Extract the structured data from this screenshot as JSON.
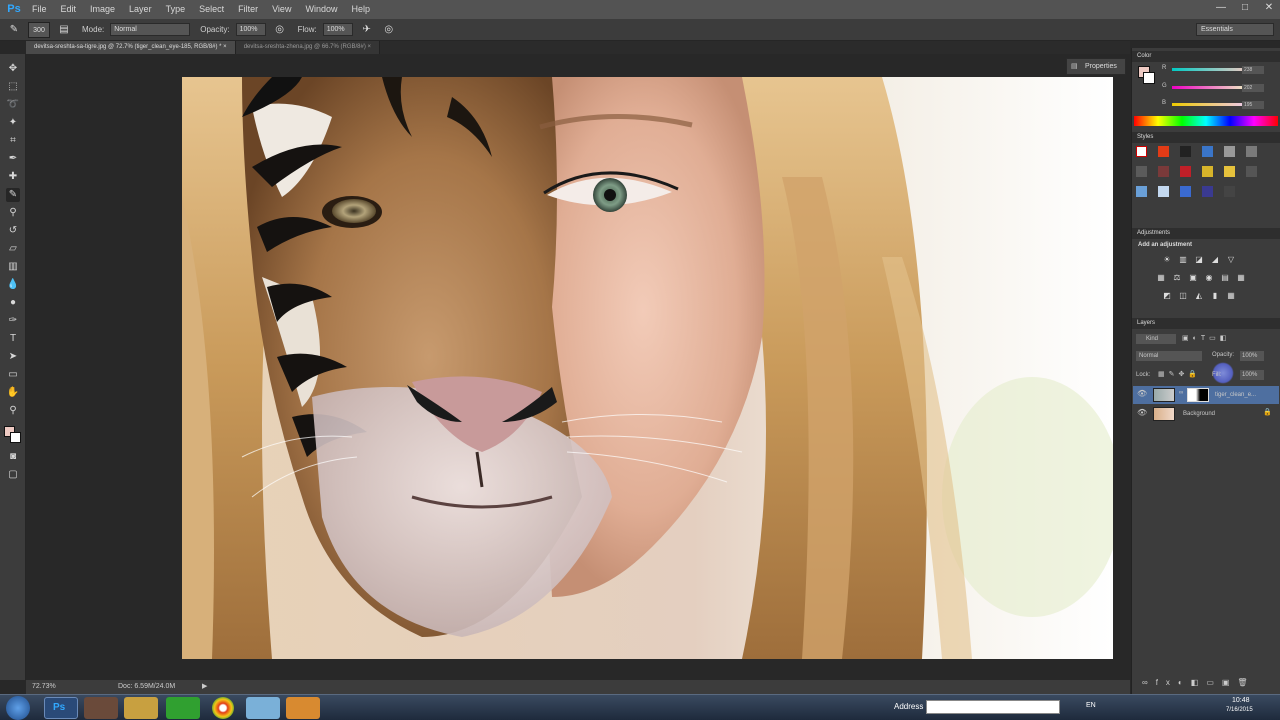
{
  "app": {
    "logo": "Ps",
    "menu": [
      "File",
      "Edit",
      "Image",
      "Layer",
      "Type",
      "Select",
      "Filter",
      "View",
      "Window",
      "Help"
    ],
    "window_controls": [
      "—",
      "□",
      "✕"
    ]
  },
  "options": {
    "brush_size": "300",
    "mode_label": "Mode:",
    "mode_value": "Normal",
    "opacity_label": "Opacity:",
    "opacity_value": "100%",
    "flow_label": "Flow:",
    "flow_value": "100%",
    "workspace": "Essentials"
  },
  "tabs": [
    {
      "label": "devitsa-sreshta-sa-tigre.jpg @ 72.7% (tiger_clean_eye-185, RGB/8#) *  ×",
      "active": true
    },
    {
      "label": "devitsa-sreshta-zhena.jpg @ 66.7% (RGB/8#)  ×",
      "active": false
    }
  ],
  "status": {
    "zoom": "72.73%",
    "doc_size": "Doc: 6.59M/24.0M"
  },
  "properties_button": "Properties",
  "color_panel": {
    "title": "Color",
    "channels": [
      "R",
      "G",
      "B"
    ],
    "values": [
      "238",
      "202",
      "195"
    ],
    "fg": "#eecac3",
    "bg": "#ffffff"
  },
  "swatches_panel": {
    "title": "Styles"
  },
  "adjustments_panel": {
    "title": "Adjustments",
    "subtitle": "Add an adjustment",
    "row1": [
      "☀",
      "▥",
      "◪",
      "◢",
      "▽"
    ],
    "row2": [
      "▦",
      "⚖",
      "▣",
      "◉",
      "▤",
      "▦"
    ],
    "row3": [
      "◩",
      "◫",
      "◭",
      "▮",
      "▦"
    ]
  },
  "layers_panel": {
    "title": "Layers",
    "kind_filter": "Kind",
    "blend_mode": "Normal",
    "opacity_label": "Opacity:",
    "opacity_value": "100%",
    "lock_label": "Lock:",
    "fill_label": "Fill:",
    "fill_value": "100%",
    "layers": [
      {
        "name": "tiger_clean_e...",
        "selected": true
      },
      {
        "name": "Background",
        "selected": false
      }
    ]
  },
  "taskbar": {
    "address_label": "Address",
    "language": "EN",
    "time": "10:48",
    "date": "7/16/2015"
  }
}
